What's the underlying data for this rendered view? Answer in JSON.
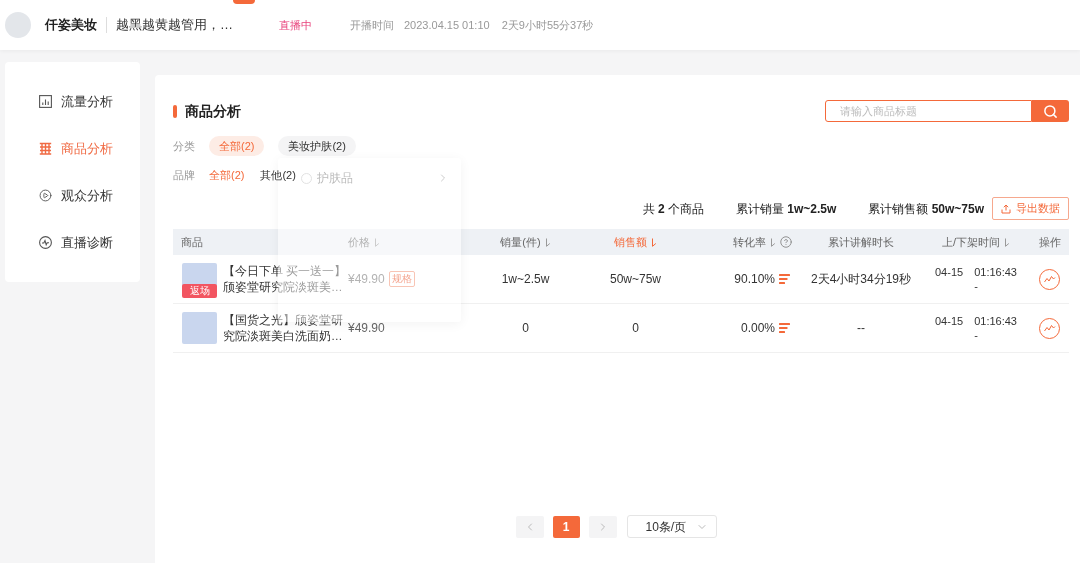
{
  "top_bar": {
    "store_name": "仟姿美妆",
    "live_title": "越黑越黄越管用，…",
    "status": "直播中",
    "start_label": "开播时间",
    "start_time": "2023.04.15 01:10",
    "elapsed": "2天9小时55分37秒"
  },
  "sidebar": {
    "items": [
      {
        "label": "流量分析",
        "kind": "chart",
        "selected": false
      },
      {
        "label": "商品分析",
        "kind": "goods",
        "selected": true
      },
      {
        "label": "观众分析",
        "kind": "play",
        "selected": false
      },
      {
        "label": "直播诊断",
        "kind": "pulse",
        "selected": false
      }
    ]
  },
  "product_analysis": {
    "title": "商品分析",
    "search": {
      "placeholder": "请输入商品标题"
    },
    "filters": [
      {
        "label": "分类",
        "kind": "chip",
        "options": [
          {
            "label": "全部(2)",
            "selected": true
          },
          {
            "label": "美妆护肤(2)",
            "selected": false
          }
        ]
      },
      {
        "label": "品牌",
        "kind": "plain",
        "options": [
          {
            "label": "全部(2)",
            "selected": true
          },
          {
            "label": "其他(2)",
            "selected": false
          }
        ]
      }
    ],
    "category_dropdown": {
      "items": [
        {
          "label": "护肤品",
          "selected": false,
          "has_children": true
        }
      ]
    },
    "summary": [
      "共 **2** 个商品",
      "累计销量 **1w~2.5w**",
      "累计销售额 **50w~75w**"
    ],
    "export_button": "导出数据",
    "table": {
      "columns": [
        {
          "label": "商品",
          "sortable": false,
          "help": false,
          "selected": false
        },
        {
          "label": "价格",
          "sortable": true,
          "help": false,
          "selected": false
        },
        {
          "label": "销量(件)",
          "sortable": true,
          "help": false,
          "selected": false
        },
        {
          "label": "销售额",
          "sortable": true,
          "help": false,
          "selected": true
        },
        {
          "label": "转化率",
          "sortable": true,
          "help": true,
          "selected": false
        },
        {
          "label": "累计讲解时长",
          "sortable": false,
          "help": false,
          "selected": false
        },
        {
          "label": "上/下架时间",
          "sortable": true,
          "help": false,
          "selected": false
        },
        {
          "label": "操作",
          "sortable": false,
          "help": false,
          "selected": false
        }
      ],
      "rows": [
        {
          "title": "【今日下单 买一送一】颀姿堂研究院淡斑美…",
          "badge": "返场",
          "price": "¥49.90",
          "tag": "规格",
          "sales": "1w~2.5w",
          "revenue": "50w~75w",
          "conversion": "90.10%",
          "explain_duration": "2天4小时34分19秒",
          "on_date": "04-15",
          "on_time": "01:16:43",
          "off_time": "-"
        },
        {
          "title": "【国货之光】颀姿堂研究院淡斑美白洗面奶…",
          "price": "¥49.90",
          "sales": "0",
          "revenue": "0",
          "conversion": "0.00%",
          "explain_duration": "--",
          "on_date": "04-15",
          "on_time": "01:16:43",
          "off_time": "-"
        }
      ]
    },
    "pagination": {
      "pages": [
        {
          "label": "1",
          "selected": true
        }
      ],
      "page_size": "10条/页"
    }
  }
}
